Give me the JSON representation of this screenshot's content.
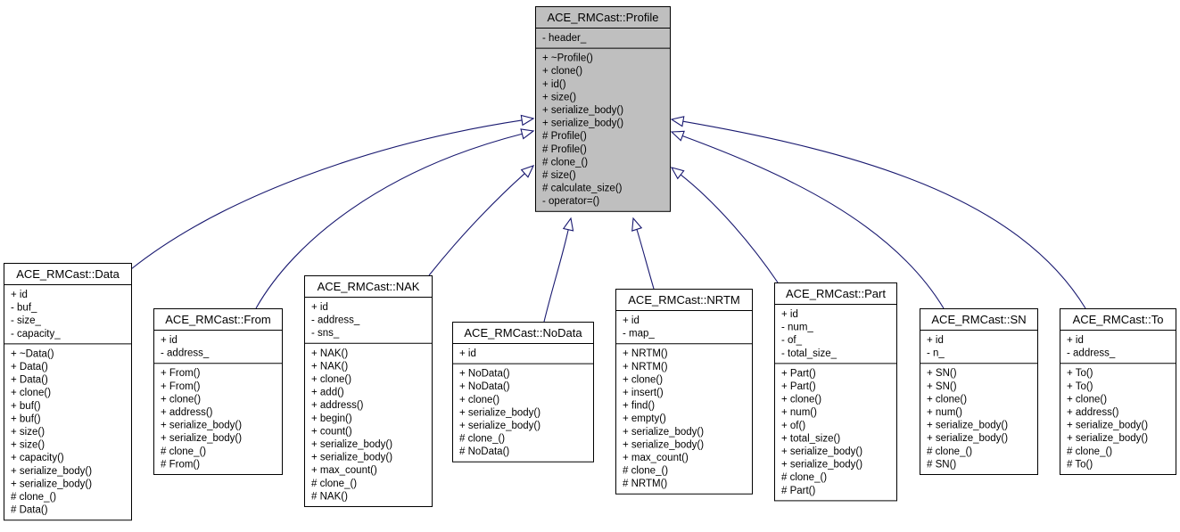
{
  "diagram": {
    "type": "class-inheritance",
    "colors": {
      "base_fill": "#bfbfbf",
      "derived_fill": "#ffffff",
      "edge": "#191970",
      "border": "#000000"
    },
    "base": {
      "name": "ACE_RMCast::Profile",
      "attributes": [
        "- header_"
      ],
      "methods": [
        "+ ~Profile()",
        "+ clone()",
        "+ id()",
        "+ size()",
        "+ serialize_body()",
        "+ serialize_body()",
        "# Profile()",
        "# Profile()",
        "# clone_()",
        "# size()",
        "# calculate_size()",
        "- operator=()"
      ]
    },
    "derived": [
      {
        "name": "ACE_RMCast::Data",
        "attributes": [
          "+ id",
          "- buf_",
          "- size_",
          "- capacity_"
        ],
        "methods": [
          "+ ~Data()",
          "+ Data()",
          "+ Data()",
          "+ clone()",
          "+ buf()",
          "+ buf()",
          "+ size()",
          "+ size()",
          "+ capacity()",
          "+ serialize_body()",
          "+ serialize_body()",
          "# clone_()",
          "# Data()"
        ]
      },
      {
        "name": "ACE_RMCast::From",
        "attributes": [
          "+ id",
          "- address_"
        ],
        "methods": [
          "+ From()",
          "+ From()",
          "+ clone()",
          "+ address()",
          "+ serialize_body()",
          "+ serialize_body()",
          "# clone_()",
          "# From()"
        ]
      },
      {
        "name": "ACE_RMCast::NAK",
        "attributes": [
          "+ id",
          "- address_",
          "- sns_"
        ],
        "methods": [
          "+ NAK()",
          "+ NAK()",
          "+ clone()",
          "+ add()",
          "+ address()",
          "+ begin()",
          "+ count()",
          "+ serialize_body()",
          "+ serialize_body()",
          "+ max_count()",
          "# clone_()",
          "# NAK()"
        ]
      },
      {
        "name": "ACE_RMCast::NoData",
        "attributes": [
          "+ id"
        ],
        "methods": [
          "+ NoData()",
          "+ NoData()",
          "+ clone()",
          "+ serialize_body()",
          "+ serialize_body()",
          "# clone_()",
          "# NoData()"
        ]
      },
      {
        "name": "ACE_RMCast::NRTM",
        "attributes": [
          "+ id",
          "- map_"
        ],
        "methods": [
          "+ NRTM()",
          "+ NRTM()",
          "+ clone()",
          "+ insert()",
          "+ find()",
          "+ empty()",
          "+ serialize_body()",
          "+ serialize_body()",
          "+ max_count()",
          "# clone_()",
          "# NRTM()"
        ]
      },
      {
        "name": "ACE_RMCast::Part",
        "attributes": [
          "+ id",
          "- num_",
          "- of_",
          "- total_size_"
        ],
        "methods": [
          "+ Part()",
          "+ Part()",
          "+ clone()",
          "+ num()",
          "+ of()",
          "+ total_size()",
          "+ serialize_body()",
          "+ serialize_body()",
          "# clone_()",
          "# Part()"
        ]
      },
      {
        "name": "ACE_RMCast::SN",
        "attributes": [
          "+ id",
          "- n_"
        ],
        "methods": [
          "+ SN()",
          "+ SN()",
          "+ clone()",
          "+ num()",
          "+ serialize_body()",
          "+ serialize_body()",
          "# clone_()",
          "# SN()"
        ]
      },
      {
        "name": "ACE_RMCast::To",
        "attributes": [
          "+ id",
          "- address_"
        ],
        "methods": [
          "+ To()",
          "+ To()",
          "+ clone()",
          "+ address()",
          "+ serialize_body()",
          "+ serialize_body()",
          "# clone_()",
          "# To()"
        ]
      }
    ]
  }
}
